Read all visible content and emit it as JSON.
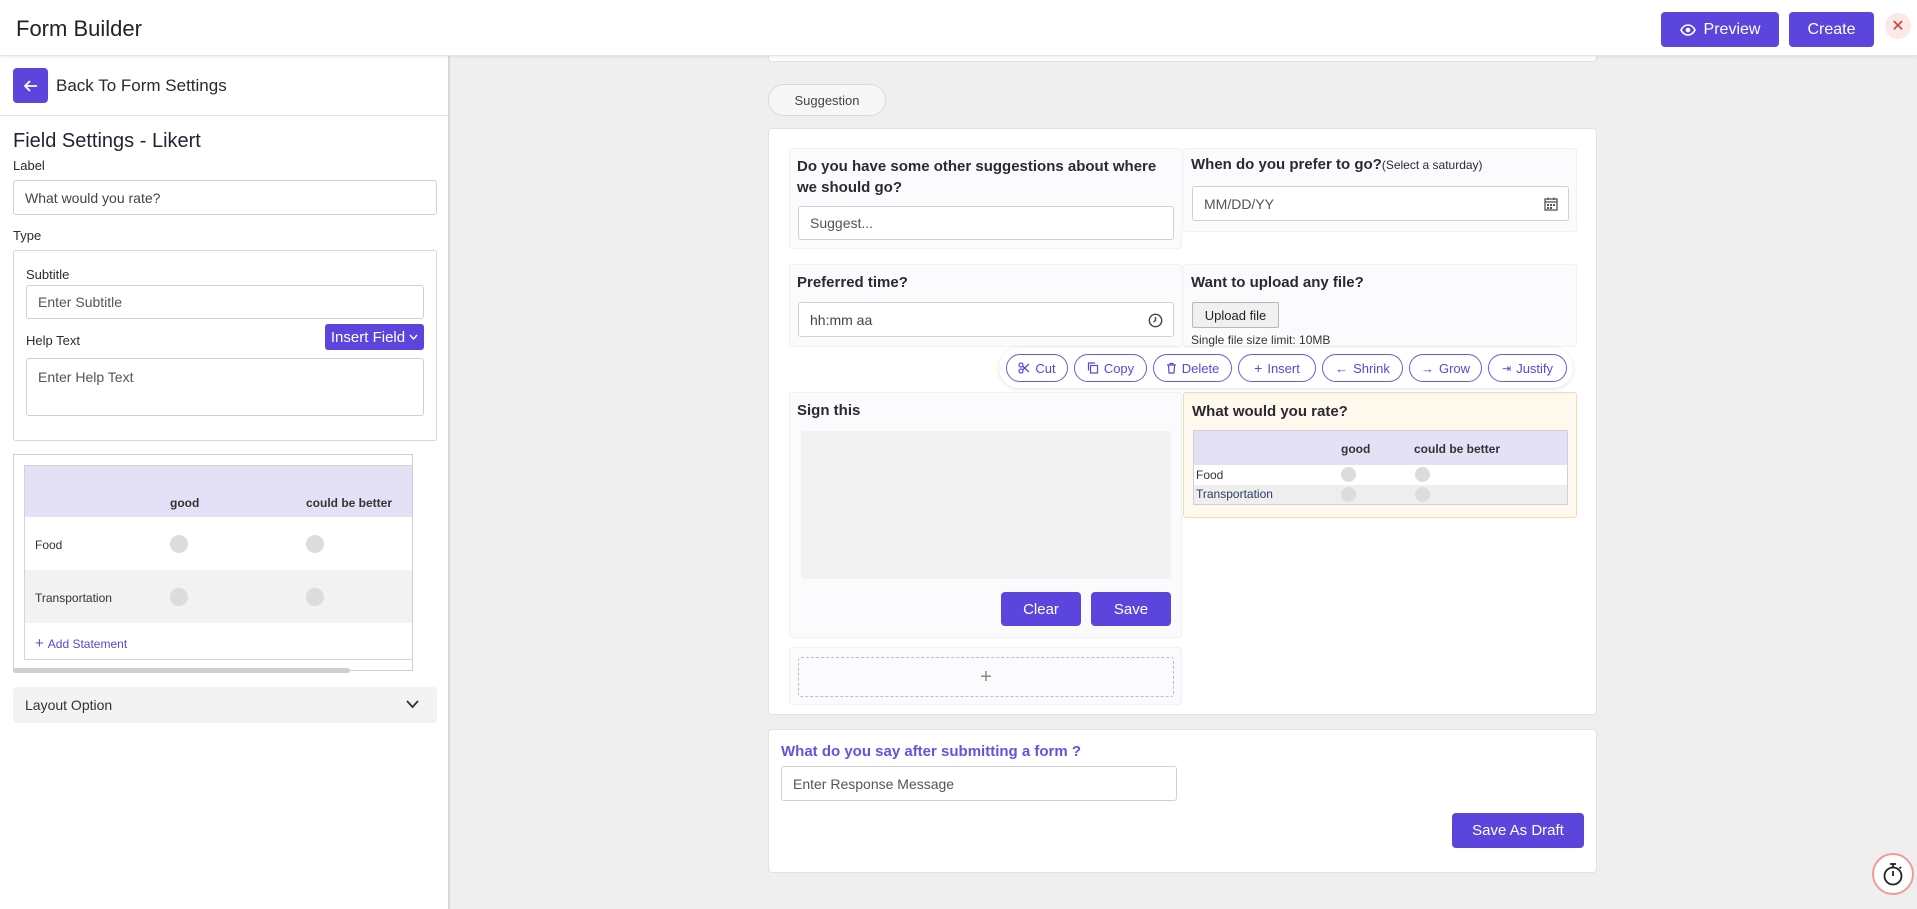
{
  "header": {
    "title": "Form Builder",
    "preview_label": "Preview",
    "create_label": "Create",
    "close_symbol": "✕"
  },
  "sidebar": {
    "back_label": "Back To Form Settings",
    "section_title": "Field Settings - Likert",
    "label_caption": "Label",
    "label_value": "What would you rate?",
    "type_caption": "Type",
    "subtitle_caption": "Subtitle",
    "subtitle_placeholder": "Enter Subtitle",
    "help_caption": "Help Text",
    "help_placeholder": "Enter Help Text",
    "insert_field_label": "Insert Field",
    "likert": {
      "columns": [
        "good",
        "could be better"
      ],
      "rows": [
        "Food",
        "Transportation"
      ],
      "add_statement_label": "Add Statement"
    },
    "layout_option_label": "Layout Option"
  },
  "form": {
    "section_pill": "Suggestion",
    "fields": {
      "suggest_question": "Do you have some other suggestions about where we should go?",
      "suggest_placeholder": "Suggest...",
      "date_question": "When do you prefer to go?",
      "date_hint": "(Select a saturday)",
      "date_placeholder": "MM/DD/YY",
      "time_question": "Preferred time?",
      "time_placeholder": "hh:mm aa",
      "upload_question": "Want to upload any file?",
      "upload_button": "Upload file",
      "upload_limit": "Single file size limit: 10MB",
      "sign_question": "Sign this",
      "clear_label": "Clear",
      "save_label": "Save",
      "rate_question": "What would you rate?",
      "add_symbol": "+"
    },
    "toolbar": {
      "cut": "Cut",
      "copy": "Copy",
      "delete": "Delete",
      "insert": "Insert",
      "shrink": "Shrink",
      "grow": "Grow",
      "justify": "Justify"
    }
  },
  "submission": {
    "question": "What do you say after submitting a form ?",
    "response_placeholder": "Enter Response Message",
    "draft_label": "Save As Draft"
  },
  "colors": {
    "accent": "#5b45dc",
    "highlight_field": "#fff8ec"
  }
}
